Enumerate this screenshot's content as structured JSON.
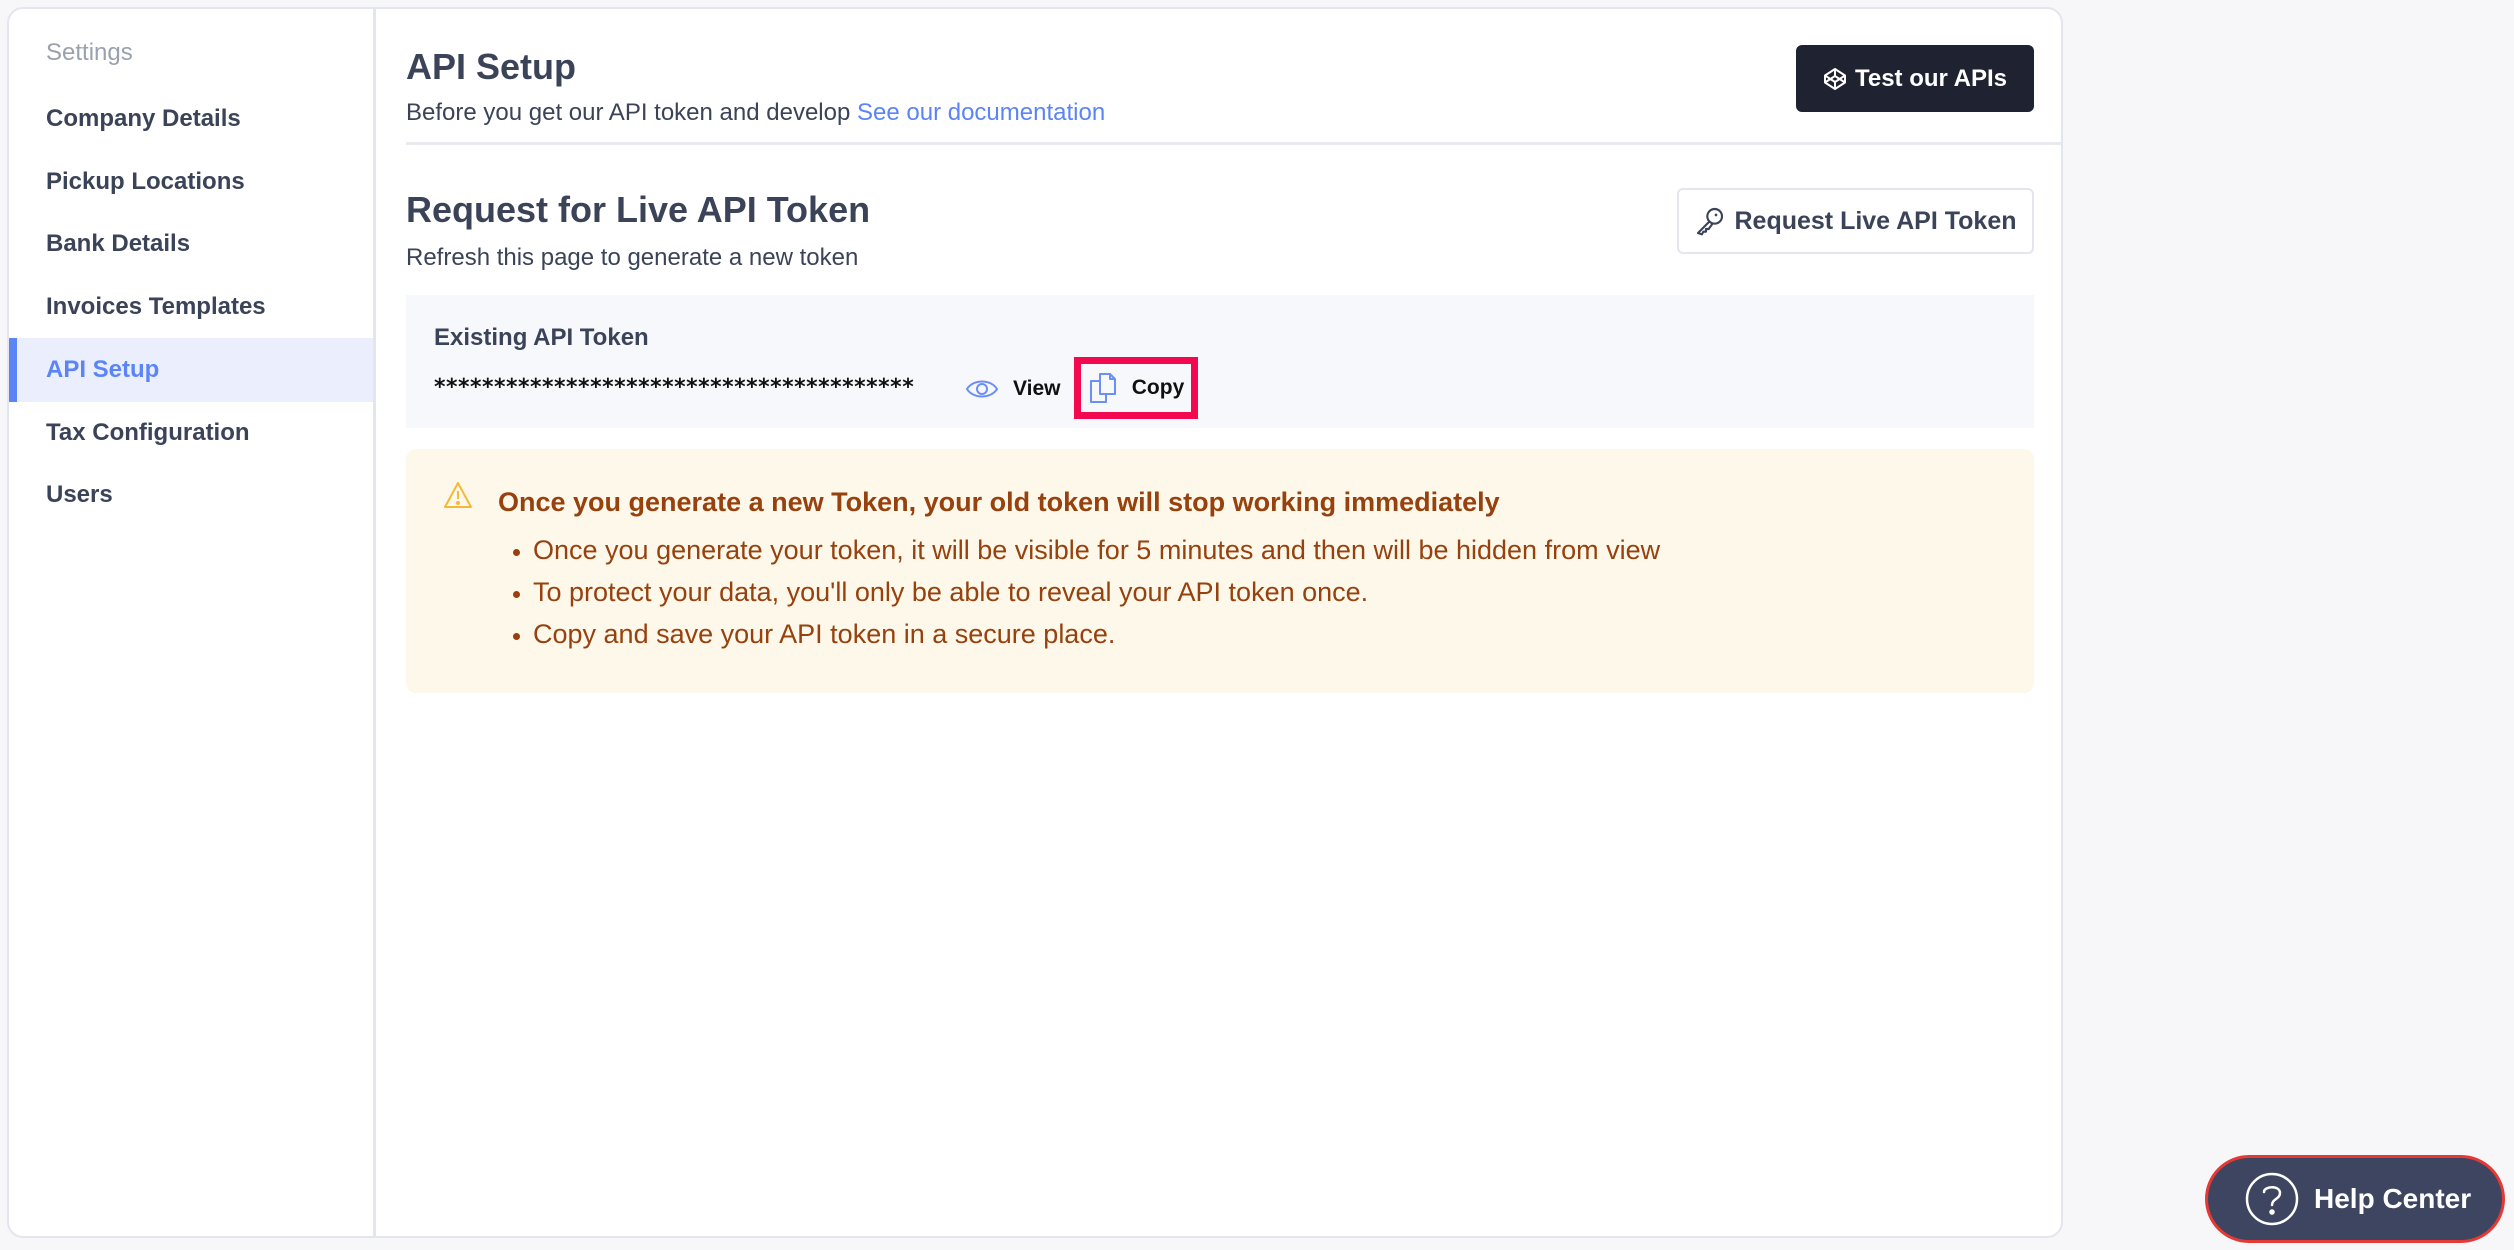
{
  "sidebar": {
    "heading": "Settings",
    "items": [
      {
        "label": "Company Details",
        "active": false
      },
      {
        "label": "Pickup Locations",
        "active": false
      },
      {
        "label": "Bank Details",
        "active": false
      },
      {
        "label": "Invoices Templates",
        "active": false
      },
      {
        "label": "API Setup",
        "active": true
      },
      {
        "label": "Tax Configuration",
        "active": false
      },
      {
        "label": "Users",
        "active": false
      }
    ]
  },
  "header": {
    "title": "API Setup",
    "subtitle": "Before you get our API token and develop",
    "doc_link": "See our documentation",
    "test_button": {
      "label": "Test our APIs",
      "icon": "codepen-cube-icon"
    }
  },
  "token_section": {
    "title": "Request for Live API Token",
    "subtitle": "Refresh this page to generate a new token",
    "request_button": {
      "label": "Request Live API Token",
      "icon": "key-icon"
    },
    "existing_label": "Existing API Token",
    "masked_token": "****************************************",
    "view_label": "View",
    "copy_label": "Copy"
  },
  "warning": {
    "title": "Once you generate a new Token, your old token will stop working immediately",
    "items": [
      "Once you generate your token, it will be visible for 5 minutes and then will be hidden from view",
      "To protect your data, you'll only be able to reveal your API token once.",
      "Copy and save your API token in a secure place."
    ]
  },
  "help": {
    "label": "Help Center",
    "icon": "question-circle-icon"
  },
  "colors": {
    "accent": "#5b84f7",
    "dark_button": "#1f2230",
    "warning_text": "#96410e",
    "warning_bg": "#fdf8e9",
    "highlight_border": "#f2094f",
    "help_bg": "#3d4560"
  }
}
